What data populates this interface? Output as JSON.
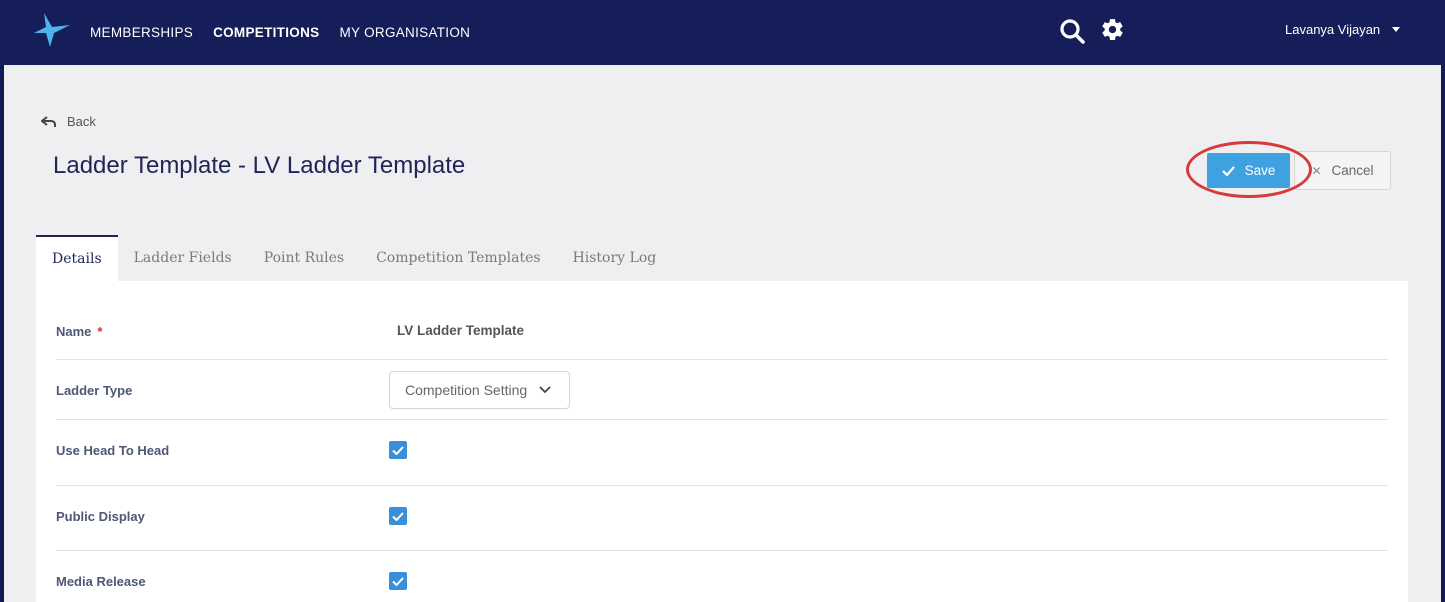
{
  "nav": {
    "items": [
      {
        "label": "MEMBERSHIPS",
        "active": false
      },
      {
        "label": "COMPETITIONS",
        "active": true
      },
      {
        "label": "MY ORGANISATION",
        "active": false
      }
    ]
  },
  "user": {
    "name": "Lavanya Vijayan"
  },
  "back_label": "Back",
  "page_title": "Ladder Template - LV Ladder Template",
  "actions": {
    "save_label": "Save",
    "cancel_label": "Cancel"
  },
  "tabs": [
    {
      "label": "Details",
      "active": true
    },
    {
      "label": "Ladder Fields",
      "active": false
    },
    {
      "label": "Point Rules",
      "active": false
    },
    {
      "label": "Competition Templates",
      "active": false
    },
    {
      "label": "History Log",
      "active": false
    }
  ],
  "form": {
    "name": {
      "label": "Name",
      "required_mark": "*",
      "value": "LV Ladder Template"
    },
    "ladder_type": {
      "label": "Ladder Type",
      "value": "Competition Setting"
    },
    "use_head_to_head": {
      "label": "Use Head To Head",
      "checked": true
    },
    "public_display": {
      "label": "Public Display",
      "checked": true
    },
    "media_release": {
      "label": "Media Release",
      "checked": true
    }
  },
  "colors": {
    "navbar": "#151e59",
    "accent": "#3fa2e0",
    "highlight": "#d63b3b"
  }
}
